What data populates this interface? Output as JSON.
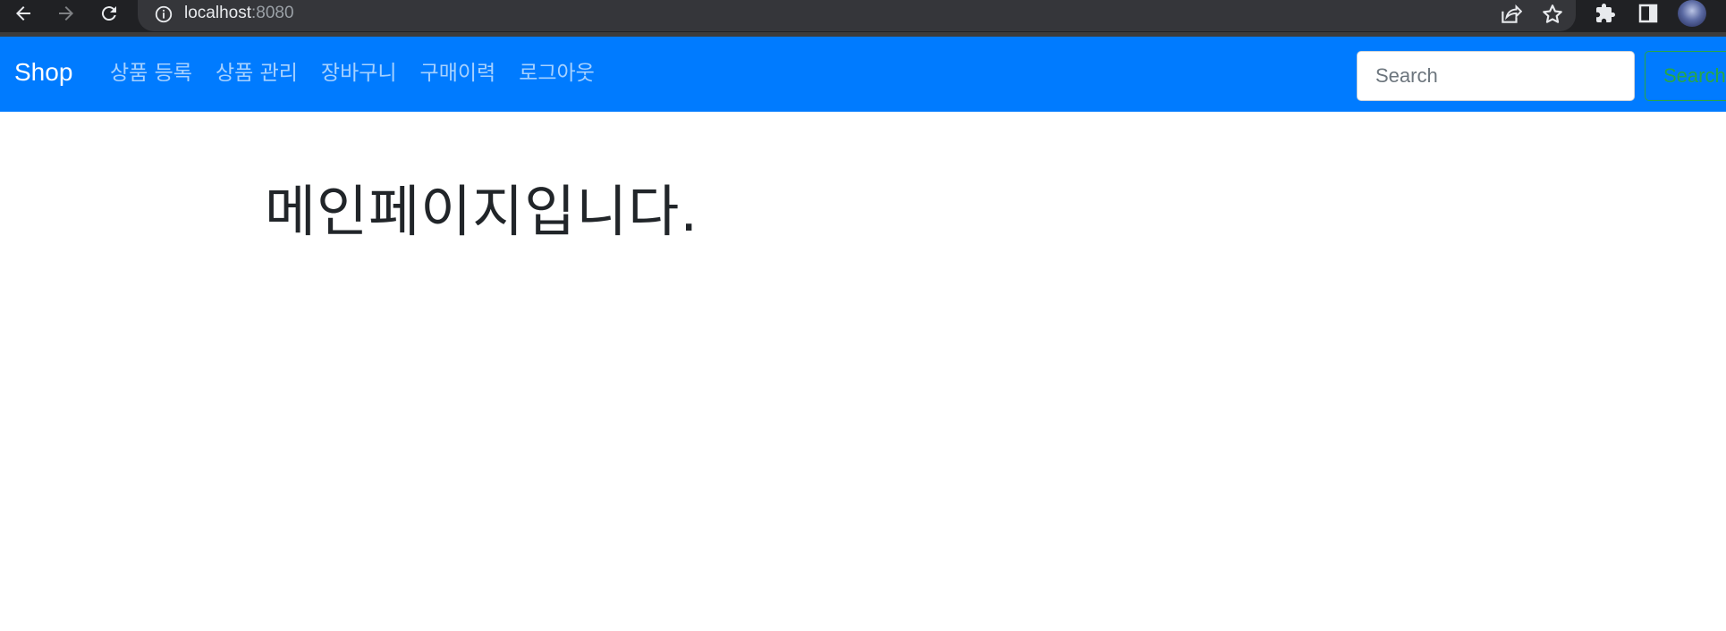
{
  "browser": {
    "url_host": "localhost",
    "url_port": ":8080"
  },
  "navbar": {
    "brand": "Shop",
    "links": [
      "상품 등록",
      "상품 관리",
      "장바구니",
      "구매이력",
      "로그아웃"
    ],
    "search_placeholder": "Search",
    "search_button": "Search",
    "color": "#007bff"
  },
  "main": {
    "heading": "메인페이지입니다."
  }
}
